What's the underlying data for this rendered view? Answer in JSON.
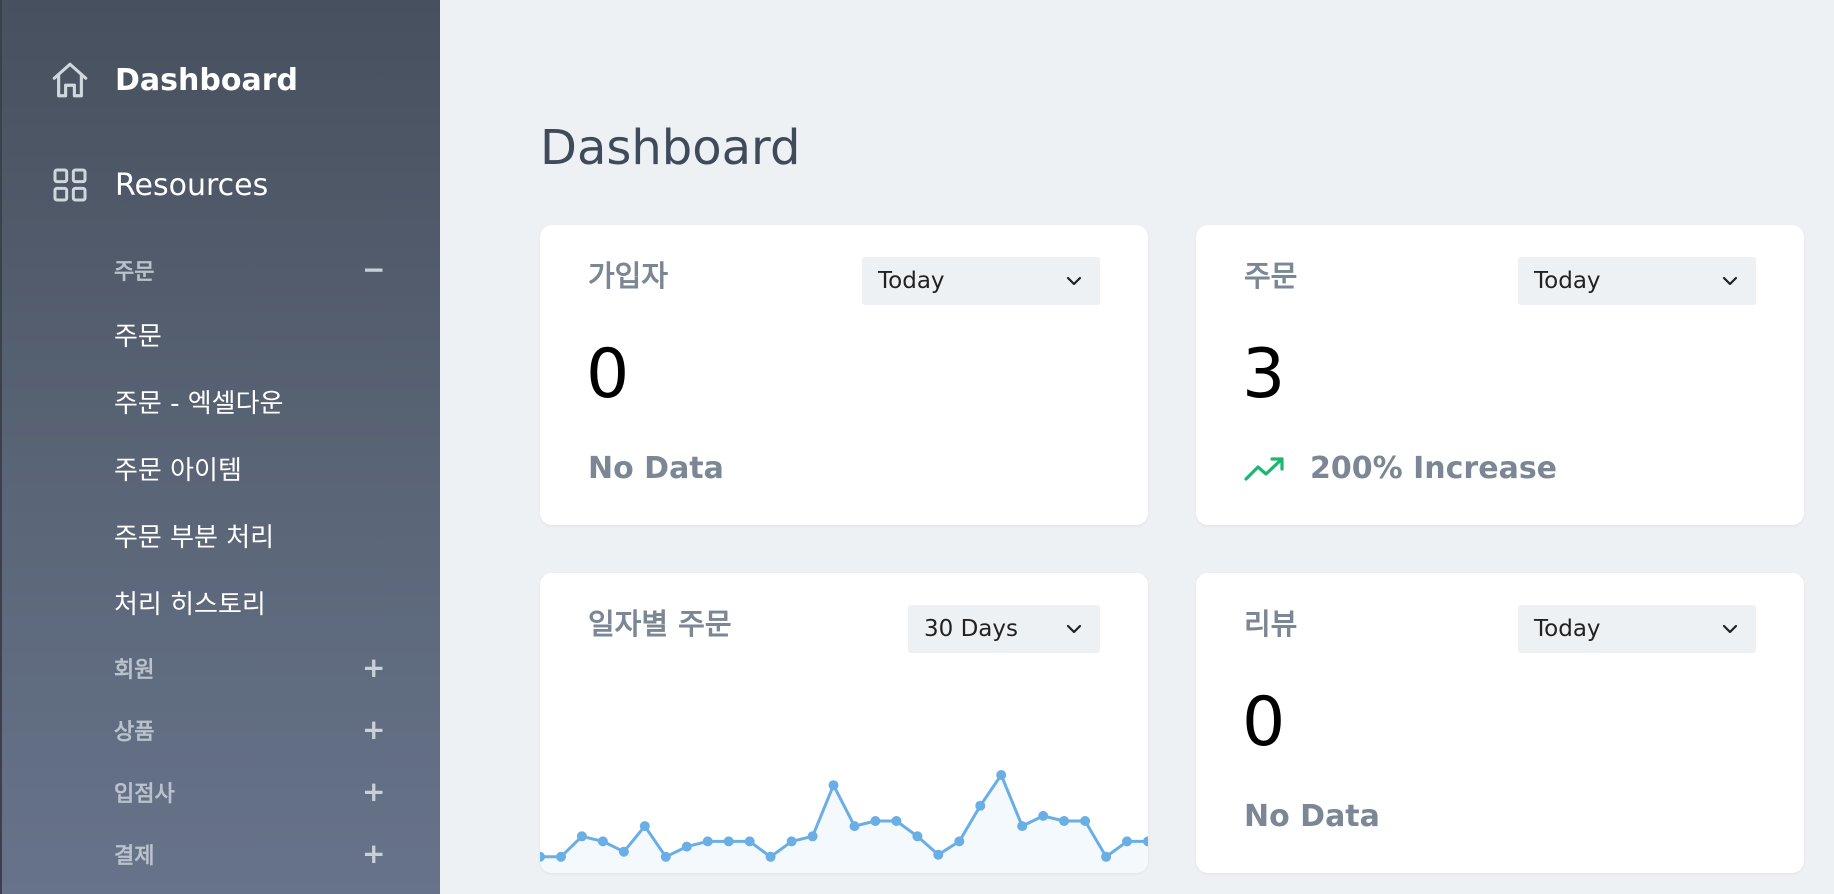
{
  "sidebar": {
    "dashboard": {
      "label": "Dashboard",
      "icon": "home-icon"
    },
    "resources": {
      "label": "Resources",
      "icon": "grid-icon"
    },
    "groups": [
      {
        "label": "주문",
        "sign": "−",
        "items": [
          "주문",
          "주문 - 엑셀다운",
          "주문 아이템",
          "주문 부분 처리",
          "처리 히스토리"
        ]
      },
      {
        "label": "회원",
        "sign": "+"
      },
      {
        "label": "상품",
        "sign": "+"
      },
      {
        "label": "입점사",
        "sign": "+"
      },
      {
        "label": "결제",
        "sign": "+"
      }
    ]
  },
  "page": {
    "title": "Dashboard"
  },
  "cards": {
    "signups": {
      "title": "가입자",
      "range": "Today",
      "value": "0",
      "footer": "No Data"
    },
    "orders": {
      "title": "주문",
      "range": "Today",
      "value": "3",
      "footer": "200% Increase",
      "trend": "up"
    },
    "daily_orders": {
      "title": "일자별 주문",
      "range": "30 Days"
    },
    "reviews": {
      "title": "리뷰",
      "range": "Today",
      "value": "0",
      "footer": "No Data"
    }
  },
  "colors": {
    "sidebar_top": "#47505e",
    "sidebar_bottom": "#67738a",
    "background": "#eef1f4",
    "chart_line": "#6aaee6",
    "trend_up": "#21b573"
  },
  "chart_data": {
    "type": "line",
    "series": [
      {
        "values": [
          1,
          1,
          3,
          2.5,
          1.5,
          4,
          1,
          2,
          2.5,
          2.5,
          2.5,
          1,
          2.5,
          3,
          8,
          4,
          4.5,
          4.5,
          3,
          1.2,
          2.5,
          6,
          9,
          4,
          5,
          4.5,
          4.5,
          1,
          2.5,
          2.5
        ]
      }
    ],
    "grid": false,
    "legend": false
  }
}
